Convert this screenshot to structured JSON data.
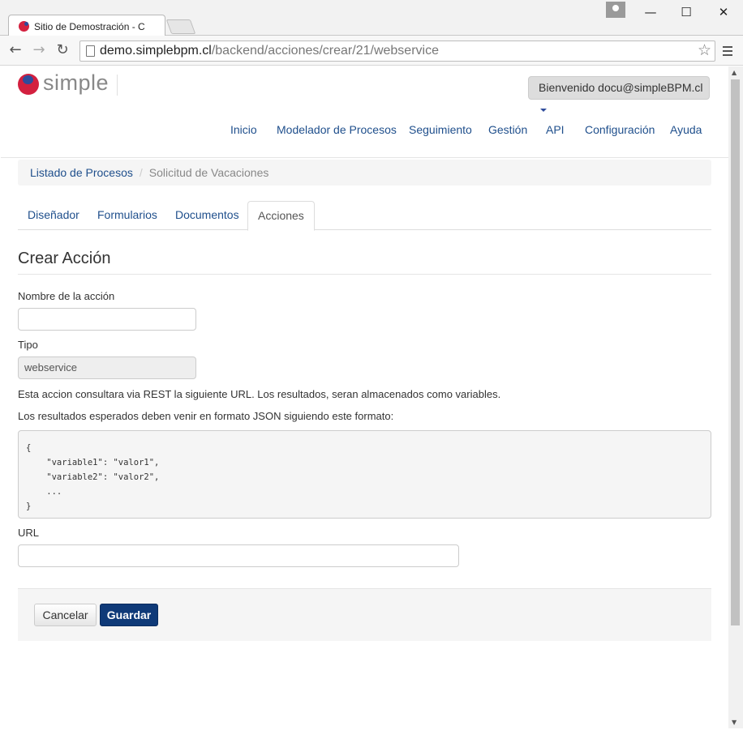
{
  "browser": {
    "tab_title": "Sitio de Demostración - C",
    "url_host": "demo.simplebpm.cl",
    "url_path": "/backend/acciones/crear/21/webservice",
    "win_minimize": "—",
    "win_maximize": "☐",
    "win_close": "✕",
    "back": "←",
    "forward": "→",
    "reload": "↻",
    "star": "☆"
  },
  "header": {
    "logo_text": "simple",
    "welcome": "Bienvenido docu@simpleBPM.cl"
  },
  "nav": {
    "items": [
      "Inicio",
      "Modelador de Procesos",
      "Seguimiento",
      "Gestión",
      "API",
      "Configuración",
      "Ayuda"
    ]
  },
  "breadcrumb": {
    "link": "Listado de Procesos",
    "separator": "/",
    "current": "Solicitud de Vacaciones"
  },
  "tabs": [
    "Diseñador",
    "Formularios",
    "Documentos",
    "Acciones"
  ],
  "active_tab": "Acciones",
  "form": {
    "title": "Crear Acción",
    "name_label": "Nombre de la acción",
    "name_value": "",
    "type_label": "Tipo",
    "type_value": "webservice",
    "help1": "Esta accion consultara via REST la siguiente URL. Los resultados, seran almacenados como variables.",
    "help2": "Los resultados esperados deben venir en formato JSON siguiendo este formato:",
    "code": "{\n    \"variable1\": \"valor1\",\n    \"variable2\": \"valor2\",\n    ...\n}",
    "url_label": "URL",
    "url_value": "",
    "cancel": "Cancelar",
    "save": "Guardar"
  },
  "colors": {
    "link": "#1f4f8c",
    "primary_button": "#0f3a78",
    "logo_red": "#d3203f",
    "logo_blue": "#2f4c9c"
  }
}
